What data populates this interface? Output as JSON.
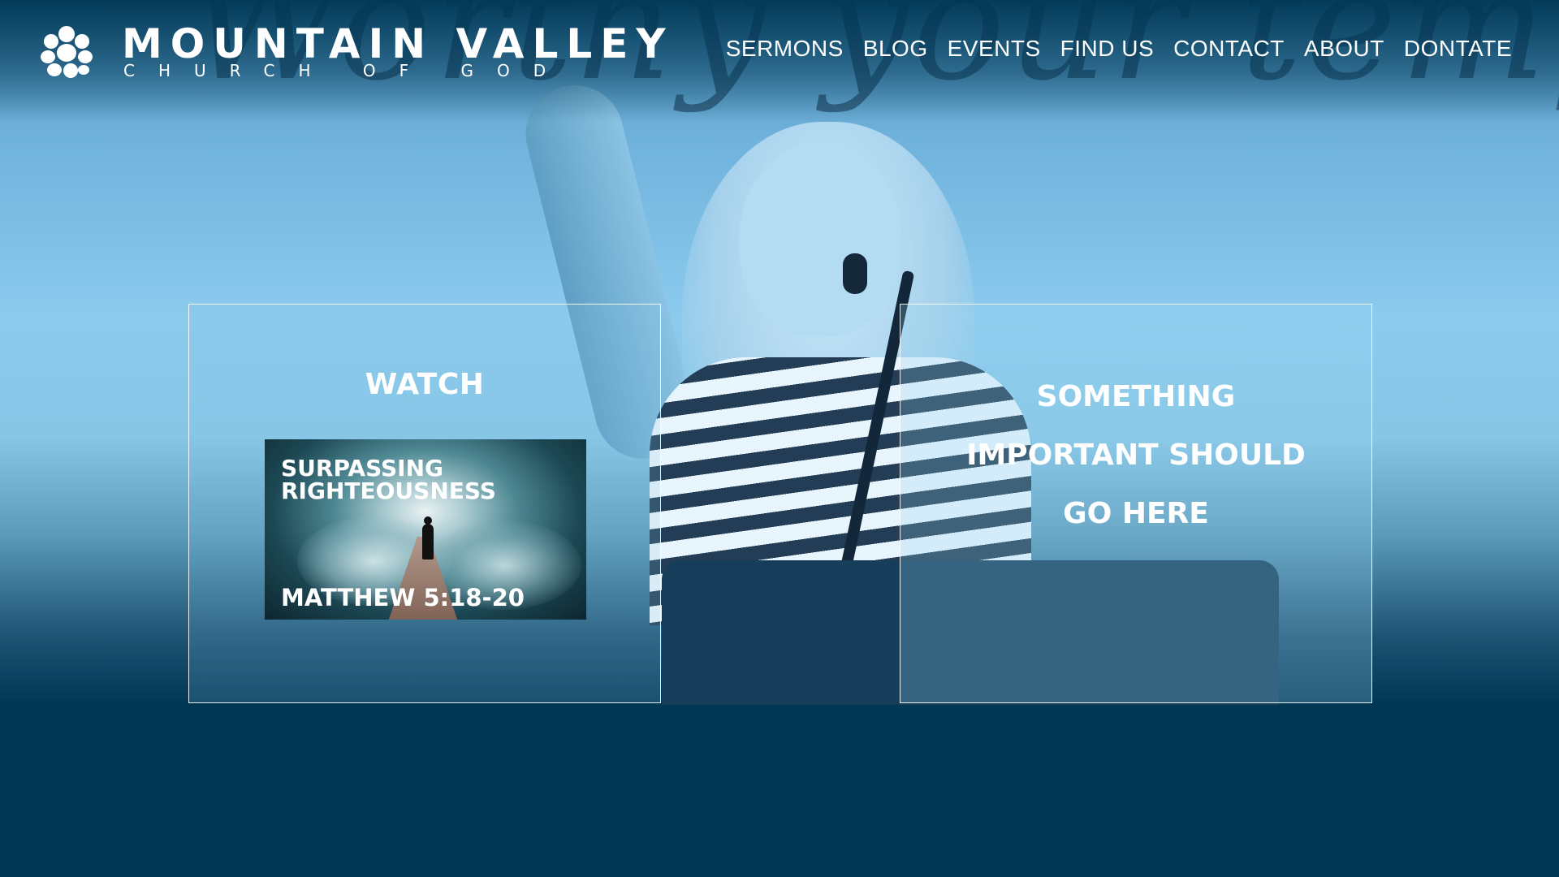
{
  "header": {
    "brand_name": "MOUNTAIN VALLEY",
    "brand_sub": "CHURCH OF GOD",
    "logo_icon": "stone-cluster-logo-icon"
  },
  "nav": {
    "items": [
      {
        "label": "SERMONS"
      },
      {
        "label": "BLOG"
      },
      {
        "label": "EVENTS"
      },
      {
        "label": "FIND US"
      },
      {
        "label": "CONTACT"
      },
      {
        "label": "ABOUT"
      },
      {
        "label": "DONTATE"
      }
    ]
  },
  "hero": {
    "background_script": "Worthy your temple, O"
  },
  "watch_card": {
    "title": "WATCH",
    "sermon": {
      "title": "SURPASSING RIGHTEOUSNESS",
      "reference": "MATTHEW 5:18-20"
    }
  },
  "notice_card": {
    "text": "SOMETHING IMPORTANT SHOULD GO HERE"
  },
  "colors": {
    "brand_dark": "#003755",
    "hero_light": "#8ccbee",
    "text": "#ffffff"
  }
}
